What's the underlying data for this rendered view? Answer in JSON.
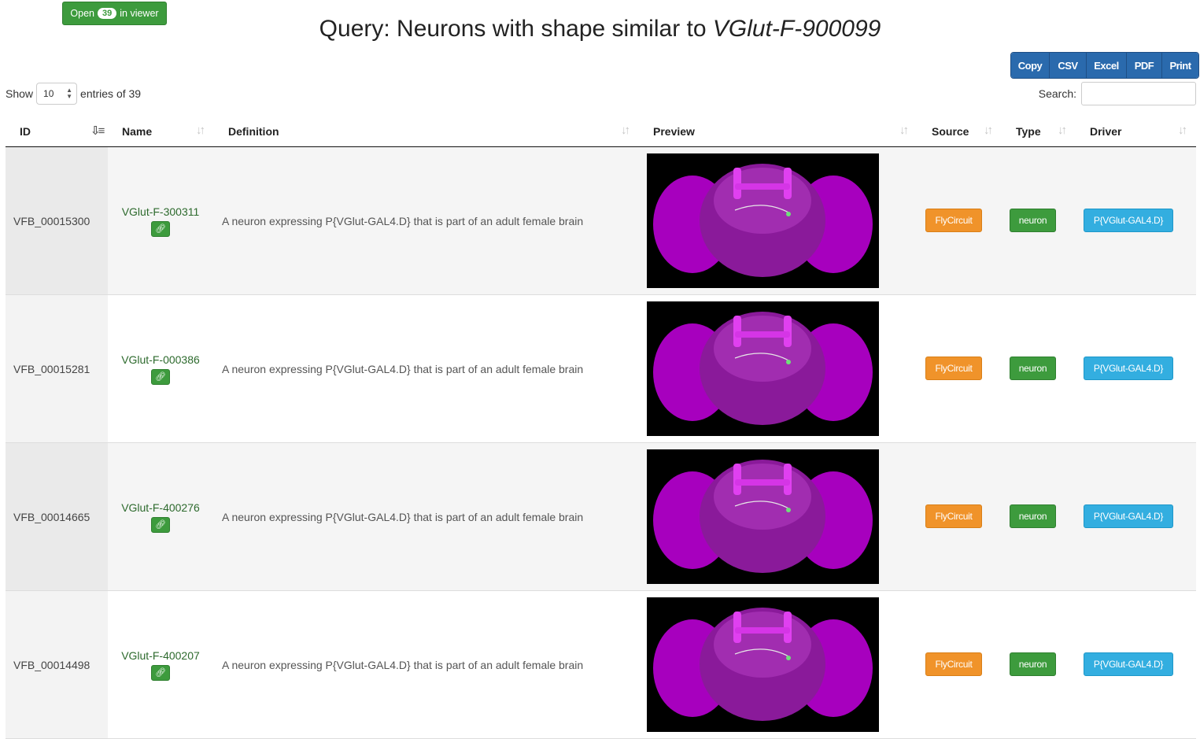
{
  "viewer_button": {
    "prefix": "Open",
    "count": "39",
    "suffix": "in viewer"
  },
  "title": {
    "prefix": "Query: Neurons with shape similar to ",
    "term": "VGlut-F-900099"
  },
  "export_buttons": [
    "Copy",
    "CSV",
    "Excel",
    "PDF",
    "Print"
  ],
  "length_control": {
    "show": "Show",
    "value": "10",
    "suffix": "entries of 39"
  },
  "search": {
    "label": "Search:",
    "value": ""
  },
  "columns": [
    "ID",
    "Name",
    "Definition",
    "Preview",
    "Source",
    "Type",
    "Driver"
  ],
  "rows": [
    {
      "id": "VFB_00015300",
      "name": "VGlut-F-300311",
      "definition": "A neuron expressing P{VGlut-GAL4.D} that is part of an adult female brain",
      "source": "FlyCircuit",
      "type": "neuron",
      "driver": "P{VGlut-GAL4.D}"
    },
    {
      "id": "VFB_00015281",
      "name": "VGlut-F-000386",
      "definition": "A neuron expressing P{VGlut-GAL4.D} that is part of an adult female brain",
      "source": "FlyCircuit",
      "type": "neuron",
      "driver": "P{VGlut-GAL4.D}"
    },
    {
      "id": "VFB_00014665",
      "name": "VGlut-F-400276",
      "definition": "A neuron expressing P{VGlut-GAL4.D} that is part of an adult female brain",
      "source": "FlyCircuit",
      "type": "neuron",
      "driver": "P{VGlut-GAL4.D}"
    },
    {
      "id": "VFB_00014498",
      "name": "VGlut-F-400207",
      "definition": "A neuron expressing P{VGlut-GAL4.D} that is part of an adult female brain",
      "source": "FlyCircuit",
      "type": "neuron",
      "driver": "P{VGlut-GAL4.D}"
    }
  ],
  "colors": {
    "green": "#3d9b3d",
    "orange": "#f0932a",
    "blue": "#2a6aad",
    "cyan": "#33aee0",
    "brain": "#b000c8"
  },
  "icons": {
    "sort": "sort-icon",
    "sort_active": "sort-desc-icon",
    "attachment": "paperclip-icon"
  }
}
